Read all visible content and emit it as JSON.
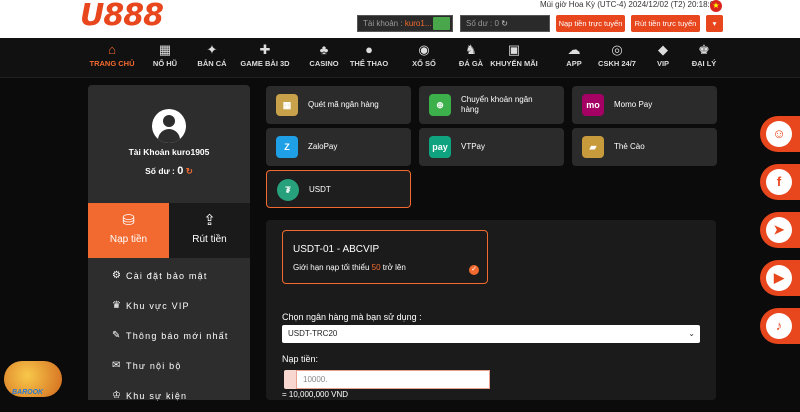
{
  "brand": {
    "logo": "U888"
  },
  "topbar": {
    "timezone": "Múi giờ Hoa Kỳ (UTC-4) 2024/12/02 (T2) 20:18:07",
    "account_label": "Tài khoản :",
    "account_value": "kuro1...",
    "balance_label": "Số dư :",
    "balance_value": "0",
    "deposit_button": "Nạp tiền trực tuyến",
    "withdraw_button": "Rút tiền trực tuyến"
  },
  "nav": [
    {
      "label": "TRANG CHỦ",
      "icon": "home-icon",
      "glyph": "⌂"
    },
    {
      "label": "NỔ HŨ",
      "icon": "slot-machine-icon",
      "glyph": "▦"
    },
    {
      "label": "BẮN CÁ",
      "icon": "fish-icon",
      "glyph": "✦"
    },
    {
      "label": "GAME BÀI 3D",
      "icon": "gamepad-icon",
      "glyph": "✚"
    },
    {
      "label": "CASINO",
      "icon": "casino-icon",
      "glyph": "♣"
    },
    {
      "label": "THỂ THAO",
      "icon": "soccer-icon",
      "glyph": "●"
    },
    {
      "label": "XỔ SỐ",
      "icon": "lottery-ball-icon",
      "glyph": "◉"
    },
    {
      "label": "ĐÁ GÀ",
      "icon": "rooster-icon",
      "glyph": "♞"
    },
    {
      "label": "KHUYẾN MÃI",
      "icon": "gift-icon",
      "glyph": "▣"
    },
    {
      "label": "APP",
      "icon": "cloud-icon",
      "glyph": "☁"
    },
    {
      "label": "CSKH 24/7",
      "icon": "support-icon",
      "glyph": "◎"
    },
    {
      "label": "VIP",
      "icon": "diamond-icon",
      "glyph": "◆"
    },
    {
      "label": "ĐẠI LÝ",
      "icon": "agent-icon",
      "glyph": "♚"
    }
  ],
  "account": {
    "name": "Tài Khoản kuro1905",
    "balance_label": "Số dư :",
    "balance_value": "0"
  },
  "tabs": [
    {
      "label": "Nạp tiền",
      "active": true,
      "icon": "deposit-icon"
    },
    {
      "label": "Rút tiền",
      "active": false,
      "icon": "withdraw-icon"
    }
  ],
  "menu": [
    {
      "label": "Cài đặt bảo mật",
      "icon": "security-settings-icon",
      "glyph": "⚙"
    },
    {
      "label": "Khu vực VIP",
      "icon": "crown-icon",
      "glyph": "♛"
    },
    {
      "label": "Thông báo mới nhất",
      "icon": "megaphone-icon",
      "glyph": "✎"
    },
    {
      "label": "Thư nội bộ",
      "icon": "mail-icon",
      "glyph": "✉"
    },
    {
      "label": "Khu sự kiện",
      "icon": "trophy-icon",
      "glyph": "♔"
    }
  ],
  "payment_methods": [
    {
      "label": "Quét mã ngân hàng",
      "icon": "qr-code-icon",
      "glyph": "▦",
      "color": "#c8a24a"
    },
    {
      "label": "Chuyển khoản ngân hàng",
      "icon": "globe-icon",
      "glyph": "⊕",
      "color": "#3cb04a"
    },
    {
      "label": "Momo Pay",
      "icon": "momo-icon",
      "glyph": "mo",
      "color": "#a50064"
    },
    {
      "label": "ZaloPay",
      "icon": "zalopay-icon",
      "glyph": "Z",
      "color": "#1fa0e6"
    },
    {
      "label": "VTPay",
      "icon": "vtpay-icon",
      "glyph": "pay",
      "color": "#10a37f"
    },
    {
      "label": "Thẻ Cào",
      "icon": "scratch-card-icon",
      "glyph": "▰",
      "color": "#c79a3c"
    },
    {
      "label": "USDT",
      "icon": "tether-icon",
      "glyph": "₮",
      "color": "#26a17b"
    }
  ],
  "form": {
    "channel_title": "USDT-01 - ABCVIP",
    "limit_prefix": "Giới hạn nạp tối thiểu",
    "limit_value": "50",
    "limit_suffix": "trở lên",
    "bank_label": "Chọn ngân hàng mà bạn sử dụng :",
    "bank_selected": "USDT-TRC20",
    "amount_label": "Nạp tiền:",
    "amount_value": "10000.",
    "amount_conversion": "= 10,000,000 VND"
  },
  "social": [
    {
      "icon": "chat-icon",
      "glyph": "☺"
    },
    {
      "icon": "facebook-icon",
      "glyph": "f"
    },
    {
      "icon": "telegram-icon",
      "glyph": "➤"
    },
    {
      "icon": "youtube-icon",
      "glyph": "▶"
    },
    {
      "icon": "tiktok-icon",
      "glyph": "♪"
    }
  ],
  "promo": {
    "label": "BAROOK"
  },
  "colors": {
    "accent": "#f26a2f",
    "brand": "#e8461d",
    "panel": "#2d2d2d"
  }
}
